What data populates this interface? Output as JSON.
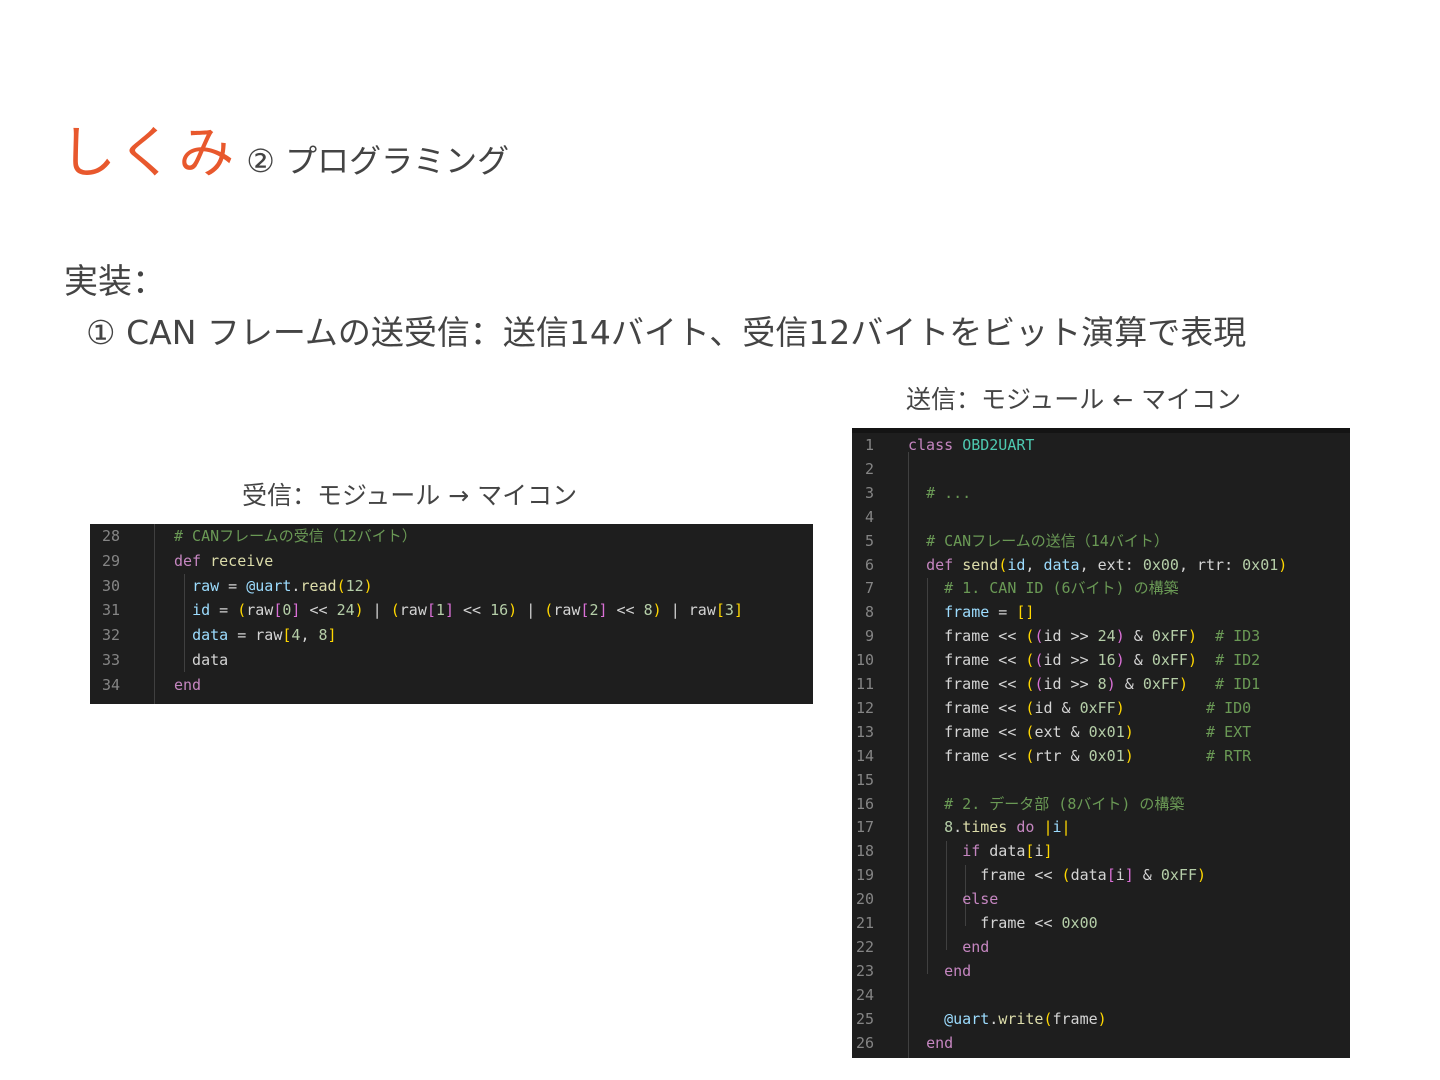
{
  "title": {
    "main": "しくみ",
    "sub": "② プログラミング"
  },
  "implementation": {
    "label": "実装：",
    "line": "① CAN フレームの送受信：送信14バイト、受信12バイトをビット演算で表現"
  },
  "receive_caption": "受信：モジュール → マイコン",
  "send_caption": "送信：モジュール ← マイコン",
  "receive_code": {
    "line_numbers": [
      "28",
      "29",
      "30",
      "31",
      "32",
      "33",
      "34"
    ]
  },
  "send_code": {
    "line_numbers": [
      "1",
      "2",
      "3",
      "4",
      "5",
      "6",
      "7",
      "8",
      "9",
      "10",
      "11",
      "12",
      "13",
      "14",
      "15",
      "16",
      "17",
      "18",
      "19",
      "20",
      "21",
      "22",
      "23",
      "24",
      "25",
      "26"
    ]
  }
}
